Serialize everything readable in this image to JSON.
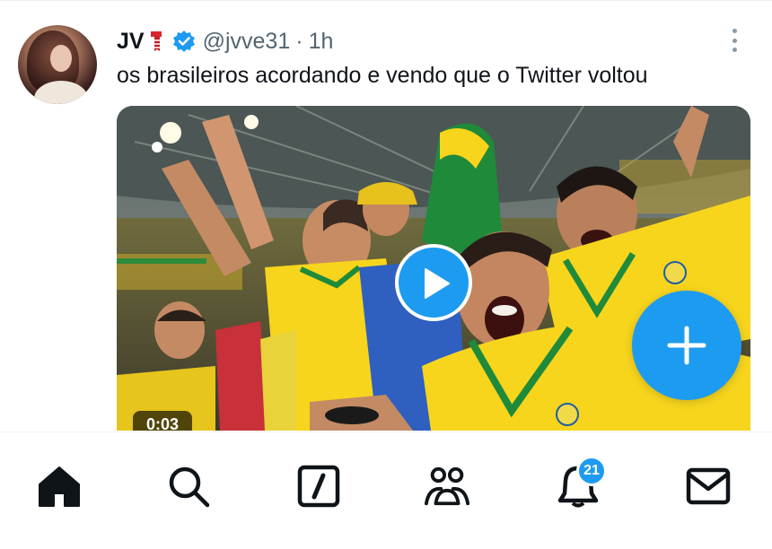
{
  "tweet": {
    "author_name": "JV",
    "handle": "@jvve31",
    "separator": "·",
    "time": "1h",
    "text": "os brasileiros acordando e vendo que o Twitter voltou",
    "video_duration": "0:03"
  },
  "nav": {
    "items": [
      "home-icon",
      "search-icon",
      "compose-icon",
      "communities-icon",
      "notifications-icon",
      "messages-icon"
    ],
    "notifications_badge": "21"
  },
  "colors": {
    "accent": "#1d9bf0",
    "text_primary": "#0f1419",
    "text_secondary": "#536471",
    "jersey_yellow": "#f7d51d",
    "jersey_green": "#1f8a3a"
  }
}
